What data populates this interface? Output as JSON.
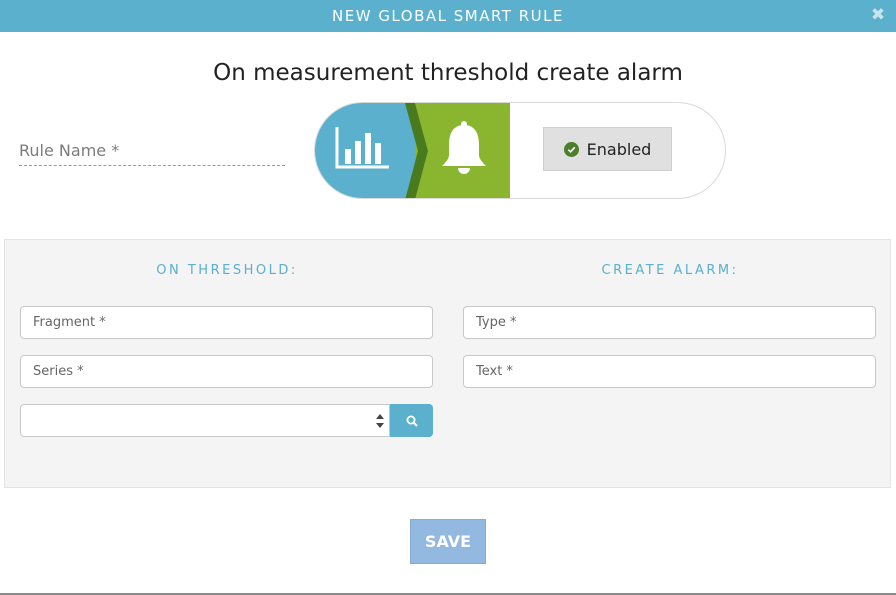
{
  "dialog": {
    "title": "NEW GLOBAL SMART RULE",
    "close_icon": "close-x-icon",
    "heading": "On measurement threshold create alarm"
  },
  "rule": {
    "name_placeholder": "Rule Name *",
    "pipeline": {
      "trigger_icon": "bar-chart-icon",
      "action_icon": "bell-icon",
      "status_icon": "check-circle-icon",
      "status_label": "Enabled"
    }
  },
  "on_threshold": {
    "title": "ON THRESHOLD:",
    "fragment_placeholder": "Fragment *",
    "series_placeholder": "Series *",
    "select_value": "",
    "search_icon": "search-icon"
  },
  "create_alarm": {
    "title": "CREATE ALARM:",
    "type_placeholder": "Type *",
    "text_placeholder": "Text *"
  },
  "footer": {
    "save_label": "SAVE"
  },
  "colors": {
    "accent": "#5ab0cd",
    "alarm_green": "#8ab62f",
    "alarm_green_dark": "#4a7a1e",
    "save_button": "#93b9e0"
  }
}
